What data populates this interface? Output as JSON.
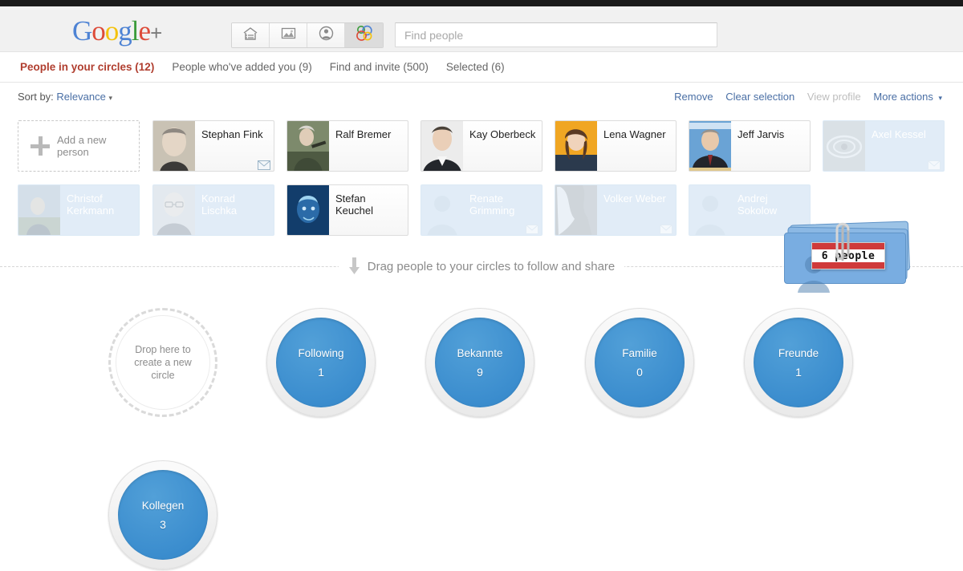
{
  "chrome": {
    "top_bar_color": "#1a1a1a"
  },
  "header": {
    "logo": {
      "g": "G",
      "o1": "o",
      "o2": "o",
      "g2": "g",
      "l": "l",
      "e": "e",
      "plus": "+"
    },
    "nav": [
      {
        "name": "home-stream-icon",
        "label": "Stream",
        "active": false
      },
      {
        "name": "photos-icon",
        "label": "Photos",
        "active": false
      },
      {
        "name": "profile-icon",
        "label": "Profile",
        "active": false
      },
      {
        "name": "circles-icon",
        "label": "Circles",
        "active": true
      }
    ],
    "search": {
      "placeholder": "Find people",
      "value": ""
    }
  },
  "tabs": [
    {
      "label": "People in your circles (12)",
      "active": true
    },
    {
      "label": "People who've added you (9)",
      "active": false
    },
    {
      "label": "Find and invite (500)",
      "active": false
    },
    {
      "label": "Selected (6)",
      "active": false
    }
  ],
  "toolbar": {
    "sort_prefix": "Sort by:",
    "sort_value": "Relevance",
    "caret": "▾",
    "remove_label": "Remove",
    "clear_selection_label": "Clear selection",
    "view_profile_label": "View profile",
    "more_actions_label": "More actions"
  },
  "add_person": {
    "line1": "Add a new",
    "line2": "person"
  },
  "people": [
    {
      "name": "Stephan Fink",
      "selected": false,
      "has_mail": true,
      "avatar": "photo-gray-suit"
    },
    {
      "name": "Ralf Bremer",
      "selected": false,
      "has_mail": false,
      "avatar": "photo-outdoor"
    },
    {
      "name": "Kay Oberbeck",
      "selected": false,
      "has_mail": false,
      "avatar": "photo-dark-suit"
    },
    {
      "name": "Lena Wagner",
      "selected": false,
      "has_mail": false,
      "avatar": "photo-orange-bg"
    },
    {
      "name": "Jeff Jarvis",
      "selected": false,
      "has_mail": false,
      "avatar": "photo-blue-bg"
    },
    {
      "name": "Axel Kessel",
      "selected": true,
      "has_mail": true,
      "avatar": "photo-eye"
    },
    {
      "name": "Christof Kerkmann",
      "selected": true,
      "has_mail": false,
      "avatar": "photo-landscape"
    },
    {
      "name": "Konrad Lischka",
      "selected": true,
      "has_mail": false,
      "avatar": "photo-glasses"
    },
    {
      "name": "Stefan Keuchel",
      "selected": false,
      "has_mail": false,
      "avatar": "photo-blue-diver"
    },
    {
      "name": "Renate Grimming",
      "selected": true,
      "has_mail": true,
      "avatar": "placeholder-person"
    },
    {
      "name": "Volker Weber",
      "selected": true,
      "has_mail": true,
      "avatar": "photo-gray-abstract"
    },
    {
      "name": "Andrej Sokolow",
      "selected": true,
      "has_mail": false,
      "avatar": "placeholder-person"
    }
  ],
  "drag_stack": {
    "badge_label": "6 people",
    "card_color": "#79ade1",
    "tag_stripe_color": "#cf3a3a"
  },
  "hint": {
    "text": "Drag people to your circles to follow and share",
    "arrow_icon": "down-arrow-icon"
  },
  "circles": {
    "new_circle": {
      "line1": "Drop here to",
      "line2": "create a new",
      "line3": "circle"
    },
    "items": [
      {
        "name": "Following",
        "count": "1"
      },
      {
        "name": "Bekannte",
        "count": "9"
      },
      {
        "name": "Familie",
        "count": "0"
      },
      {
        "name": "Freunde",
        "count": "1"
      },
      {
        "name": "Kollegen",
        "count": "3"
      }
    ],
    "accent_color": "#3b8dce"
  }
}
